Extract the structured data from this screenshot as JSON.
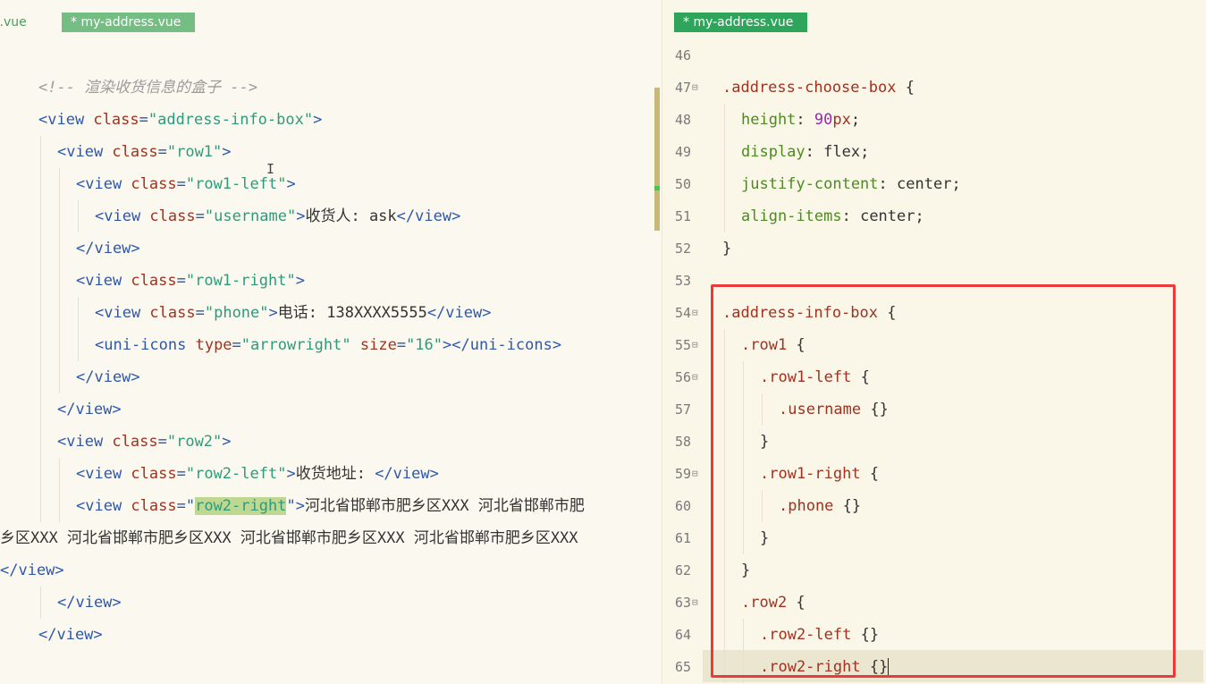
{
  "left_editor": {
    "tabs": [
      {
        "label": "t.vue",
        "active": false
      },
      {
        "label": "* my-address.vue",
        "active": true
      }
    ],
    "lines": [
      {
        "indent": 1,
        "tokens": [
          {
            "c": "cm",
            "t": "<!-- 渲染收货信息的盒子 -->"
          }
        ]
      },
      {
        "indent": 1,
        "tokens": [
          {
            "c": "tag",
            "t": "<view "
          },
          {
            "c": "attr",
            "t": "class"
          },
          {
            "c": "tag",
            "t": "="
          },
          {
            "c": "str",
            "t": "\"address-info-box\""
          },
          {
            "c": "tag",
            "t": ">"
          }
        ]
      },
      {
        "indent": 2,
        "tokens": [
          {
            "c": "tag",
            "t": "<view "
          },
          {
            "c": "attr",
            "t": "class"
          },
          {
            "c": "tag",
            "t": "="
          },
          {
            "c": "str",
            "t": "\"row1\""
          },
          {
            "c": "tag",
            "t": ">"
          }
        ]
      },
      {
        "indent": 3,
        "tokens": [
          {
            "c": "tag",
            "t": "<view "
          },
          {
            "c": "attr",
            "t": "class"
          },
          {
            "c": "tag",
            "t": "="
          },
          {
            "c": "str",
            "t": "\"row1-left\""
          },
          {
            "c": "tag",
            "t": ">"
          }
        ]
      },
      {
        "indent": 4,
        "tokens": [
          {
            "c": "tag",
            "t": "<view "
          },
          {
            "c": "attr",
            "t": "class"
          },
          {
            "c": "tag",
            "t": "="
          },
          {
            "c": "str",
            "t": "\"username\""
          },
          {
            "c": "tag",
            "t": ">"
          },
          {
            "c": "txt",
            "t": "收货人: ask"
          },
          {
            "c": "tag",
            "t": "</view>"
          }
        ]
      },
      {
        "indent": 3,
        "tokens": [
          {
            "c": "tag",
            "t": "</view>"
          }
        ]
      },
      {
        "indent": 3,
        "tokens": [
          {
            "c": "tag",
            "t": "<view "
          },
          {
            "c": "attr",
            "t": "class"
          },
          {
            "c": "tag",
            "t": "="
          },
          {
            "c": "str",
            "t": "\"row1-right\""
          },
          {
            "c": "tag",
            "t": ">"
          }
        ]
      },
      {
        "indent": 4,
        "tokens": [
          {
            "c": "tag",
            "t": "<view "
          },
          {
            "c": "attr",
            "t": "class"
          },
          {
            "c": "tag",
            "t": "="
          },
          {
            "c": "str",
            "t": "\"phone\""
          },
          {
            "c": "tag",
            "t": ">"
          },
          {
            "c": "txt",
            "t": "电话: 138XXXX5555"
          },
          {
            "c": "tag",
            "t": "</view>"
          }
        ]
      },
      {
        "indent": 4,
        "tokens": [
          {
            "c": "tag",
            "t": "<uni-icons "
          },
          {
            "c": "attr",
            "t": "type"
          },
          {
            "c": "tag",
            "t": "="
          },
          {
            "c": "str",
            "t": "\"arrowright\" "
          },
          {
            "c": "attr",
            "t": "size"
          },
          {
            "c": "tag",
            "t": "="
          },
          {
            "c": "str",
            "t": "\"16\""
          },
          {
            "c": "tag",
            "t": "></uni-icons>"
          }
        ]
      },
      {
        "indent": 3,
        "tokens": [
          {
            "c": "tag",
            "t": "</view>"
          }
        ]
      },
      {
        "indent": 2,
        "tokens": [
          {
            "c": "tag",
            "t": "</view>"
          }
        ]
      },
      {
        "indent": 2,
        "tokens": [
          {
            "c": "tag",
            "t": "<view "
          },
          {
            "c": "attr",
            "t": "class"
          },
          {
            "c": "tag",
            "t": "="
          },
          {
            "c": "str",
            "t": "\"row2\""
          },
          {
            "c": "tag",
            "t": ">"
          }
        ]
      },
      {
        "indent": 3,
        "tokens": [
          {
            "c": "tag",
            "t": "<view "
          },
          {
            "c": "attr",
            "t": "class"
          },
          {
            "c": "tag",
            "t": "="
          },
          {
            "c": "str",
            "t": "\"row2-left\""
          },
          {
            "c": "tag",
            "t": ">"
          },
          {
            "c": "txt",
            "t": "收货地址: "
          },
          {
            "c": "tag",
            "t": "</view>"
          }
        ]
      },
      {
        "indent": 3,
        "tokens": [
          {
            "c": "tag",
            "t": "<view "
          },
          {
            "c": "attr",
            "t": "class"
          },
          {
            "c": "tag",
            "t": "=\""
          },
          {
            "c": "str hl",
            "t": "row2-right"
          },
          {
            "c": "tag",
            "t": "\">"
          },
          {
            "c": "txt",
            "t": "河北省邯郸市肥乡区XXX 河北省邯郸市肥"
          }
        ]
      },
      {
        "indent": 0,
        "tokens": [
          {
            "c": "txt",
            "t": "乡区XXX 河北省邯郸市肥乡区XXX 河北省邯郸市肥乡区XXX 河北省邯郸市肥乡区XXX"
          }
        ]
      },
      {
        "indent": 0,
        "tokens": [
          {
            "c": "tag",
            "t": "</view>"
          }
        ]
      },
      {
        "indent": 2,
        "tokens": [
          {
            "c": "tag",
            "t": "</view>"
          }
        ]
      },
      {
        "indent": 1,
        "tokens": [
          {
            "c": "tag",
            "t": "</view>"
          }
        ]
      }
    ]
  },
  "right_editor": {
    "tab": {
      "label": "* my-address.vue",
      "active": true
    },
    "lines": [
      {
        "num": "46",
        "fold": false,
        "indent": 0,
        "tokens": []
      },
      {
        "num": "47",
        "fold": true,
        "indent": 0,
        "tokens": [
          {
            "c": "sel",
            "t": ".address-choose-box "
          },
          {
            "c": "punc",
            "t": "{"
          }
        ]
      },
      {
        "num": "48",
        "fold": false,
        "indent": 1,
        "tokens": [
          {
            "c": "prop",
            "t": "height"
          },
          {
            "c": "punc",
            "t": ": "
          },
          {
            "c": "num",
            "t": "90"
          },
          {
            "c": "attr",
            "t": "px"
          },
          {
            "c": "punc",
            "t": ";"
          }
        ]
      },
      {
        "num": "49",
        "fold": false,
        "indent": 1,
        "tokens": [
          {
            "c": "prop",
            "t": "display"
          },
          {
            "c": "punc",
            "t": ": "
          },
          {
            "c": "val",
            "t": "flex"
          },
          {
            "c": "punc",
            "t": ";"
          }
        ]
      },
      {
        "num": "50",
        "fold": false,
        "indent": 1,
        "tokens": [
          {
            "c": "prop",
            "t": "justify-content"
          },
          {
            "c": "punc",
            "t": ": "
          },
          {
            "c": "val",
            "t": "center"
          },
          {
            "c": "punc",
            "t": ";"
          }
        ]
      },
      {
        "num": "51",
        "fold": false,
        "indent": 1,
        "tokens": [
          {
            "c": "prop",
            "t": "align-items"
          },
          {
            "c": "punc",
            "t": ": "
          },
          {
            "c": "val",
            "t": "center"
          },
          {
            "c": "punc",
            "t": ";"
          }
        ]
      },
      {
        "num": "52",
        "fold": false,
        "indent": 0,
        "tokens": [
          {
            "c": "punc",
            "t": "}"
          }
        ]
      },
      {
        "num": "53",
        "fold": false,
        "indent": 0,
        "tokens": []
      },
      {
        "num": "54",
        "fold": true,
        "indent": 0,
        "tokens": [
          {
            "c": "sel",
            "t": ".address-info-box "
          },
          {
            "c": "punc",
            "t": "{"
          }
        ]
      },
      {
        "num": "55",
        "fold": true,
        "indent": 1,
        "tokens": [
          {
            "c": "sel",
            "t": ".row1 "
          },
          {
            "c": "punc",
            "t": "{"
          }
        ]
      },
      {
        "num": "56",
        "fold": true,
        "indent": 2,
        "tokens": [
          {
            "c": "sel",
            "t": ".row1-left "
          },
          {
            "c": "punc",
            "t": "{"
          }
        ]
      },
      {
        "num": "57",
        "fold": false,
        "indent": 3,
        "tokens": [
          {
            "c": "sel",
            "t": ".username "
          },
          {
            "c": "punc",
            "t": "{}"
          }
        ]
      },
      {
        "num": "58",
        "fold": false,
        "indent": 2,
        "tokens": [
          {
            "c": "punc",
            "t": "}"
          }
        ]
      },
      {
        "num": "59",
        "fold": true,
        "indent": 2,
        "tokens": [
          {
            "c": "sel",
            "t": ".row1-right "
          },
          {
            "c": "punc",
            "t": "{"
          }
        ]
      },
      {
        "num": "60",
        "fold": false,
        "indent": 3,
        "tokens": [
          {
            "c": "sel",
            "t": ".phone "
          },
          {
            "c": "punc",
            "t": "{}"
          }
        ]
      },
      {
        "num": "61",
        "fold": false,
        "indent": 2,
        "tokens": [
          {
            "c": "punc",
            "t": "}"
          }
        ]
      },
      {
        "num": "62",
        "fold": false,
        "indent": 1,
        "tokens": [
          {
            "c": "punc",
            "t": "}"
          }
        ]
      },
      {
        "num": "63",
        "fold": true,
        "indent": 1,
        "tokens": [
          {
            "c": "sel",
            "t": ".row2 "
          },
          {
            "c": "punc",
            "t": "{"
          }
        ]
      },
      {
        "num": "64",
        "fold": false,
        "indent": 2,
        "tokens": [
          {
            "c": "sel",
            "t": ".row2-left "
          },
          {
            "c": "punc",
            "t": "{}"
          }
        ]
      },
      {
        "num": "65",
        "fold": false,
        "indent": 2,
        "current": true,
        "tokens": [
          {
            "c": "sel",
            "t": ".row2-right "
          },
          {
            "c": "punc",
            "t": "{}"
          }
        ]
      }
    ]
  },
  "icons": {
    "fold_marker": "⊟",
    "text_cursor": "I"
  },
  "colors": {
    "tag": "#2f57a8",
    "attr": "#a03220",
    "string": "#2f9a7b",
    "css_property": "#4d8a22",
    "css_number": "#9c27b0",
    "annotation_box": "#ea3a3a",
    "active_tab": "#2ea55a"
  }
}
